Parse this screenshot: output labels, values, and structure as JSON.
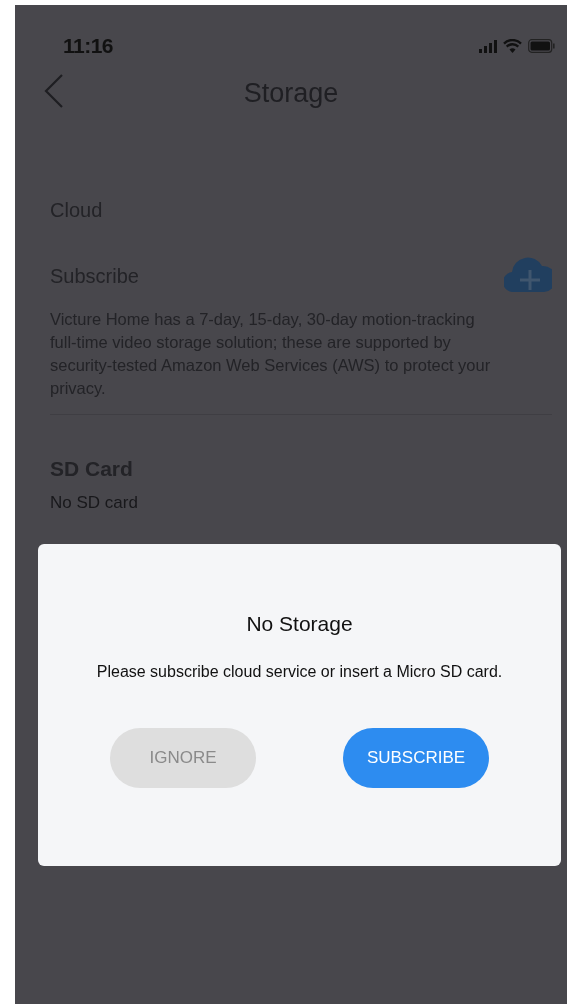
{
  "status_bar": {
    "time": "11:16"
  },
  "header": {
    "title": "Storage"
  },
  "cloud": {
    "heading": "Cloud",
    "subscribe_label": "Subscribe",
    "description": "Victure Home has a 7-day, 15-day, 30-day motion-tracking full-time video storage solution; these are supported by security-tested Amazon Web Services (AWS) to protect your privacy."
  },
  "sd_card": {
    "heading": "SD Card",
    "status": "No SD card"
  },
  "dialog": {
    "title": "No Storage",
    "message": "Please subscribe cloud service or insert a Micro SD card.",
    "buttons": [
      {
        "label": "IGNORE",
        "kind": "secondary"
      },
      {
        "label": "SUBSCRIBE",
        "kind": "primary"
      }
    ]
  }
}
